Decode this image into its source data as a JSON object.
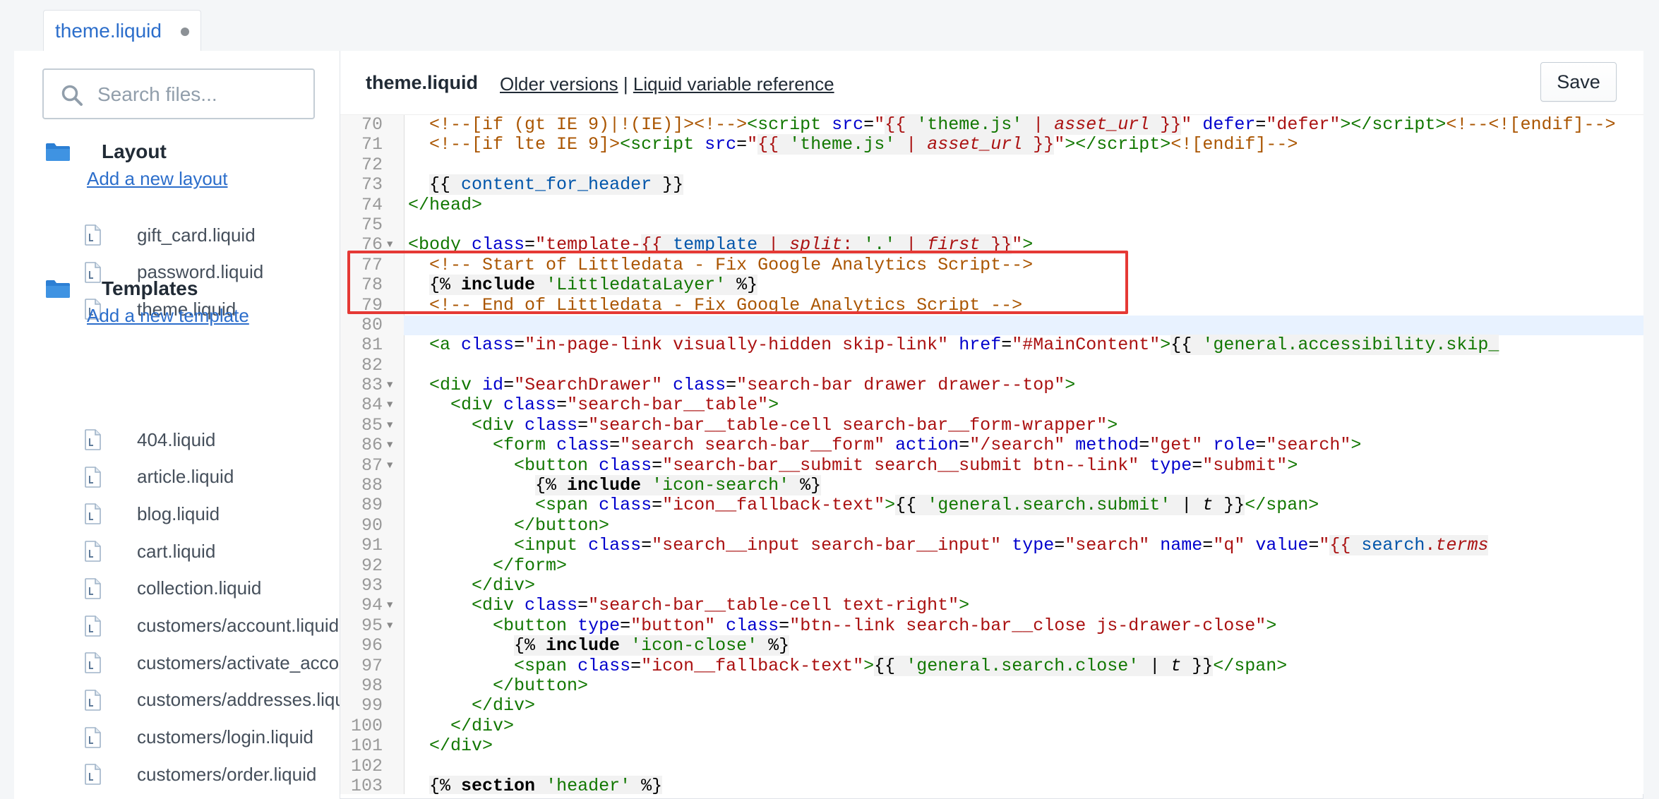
{
  "tab": {
    "label": "theme.liquid"
  },
  "sidebar": {
    "search_placeholder": "Search files...",
    "layout": {
      "title": "Layout",
      "add_link": "Add a new layout",
      "files": [
        "gift_card.liquid",
        "password.liquid",
        "theme.liquid"
      ]
    },
    "templates": {
      "title": "Templates",
      "add_link": "Add a new template",
      "files": [
        "404.liquid",
        "article.liquid",
        "blog.liquid",
        "cart.liquid",
        "collection.liquid",
        "customers/account.liquid",
        "customers/activate_account.liquid",
        "customers/addresses.liquid",
        "customers/login.liquid",
        "customers/order.liquid"
      ]
    }
  },
  "editor_header": {
    "title": "theme.liquid",
    "older_versions": "Older versions",
    "separator": "|",
    "liquid_reference": "Liquid variable reference",
    "save": "Save"
  },
  "code": {
    "active_line": 80,
    "highlighted_lines": [
      77,
      78,
      79
    ],
    "lines": [
      {
        "n": 70,
        "fold": false,
        "html": "  <span class=\"c-comment\">&lt;!--[if (gt IE 9)|!(IE)]&gt;&lt;!--&gt;</span><span class=\"c-tag\">&lt;script</span> <span class=\"c-attr\">src</span>=<span class=\"c-str\">\"<span class=\"liq-bg\">{{ <span class=\"c-lstr\">'theme.js'</span> | <span class=\"c-em\">asset_url</span> }}</span>\"</span> <span class=\"c-attr\">defer</span>=<span class=\"c-str\">\"defer\"</span><span class=\"c-tag\">&gt;&lt;/script&gt;</span><span class=\"c-comment\">&lt;!--&lt;![endif]--&gt;</span>"
      },
      {
        "n": 71,
        "fold": false,
        "html": "  <span class=\"c-comment\">&lt;!--[if lte IE 9]&gt;</span><span class=\"c-tag\">&lt;script</span> <span class=\"c-attr\">src</span>=<span class=\"c-str\">\"<span class=\"liq-bg\">{{ <span class=\"c-lstr\">'theme.js'</span> | <span class=\"c-em\">asset_url</span> }}</span>\"</span><span class=\"c-tag\">&gt;&lt;/script&gt;</span><span class=\"c-comment\">&lt;![endif]--&gt;</span>"
      },
      {
        "n": 72,
        "fold": false,
        "html": ""
      },
      {
        "n": 73,
        "fold": false,
        "html": "  <span class=\"liq-bg\">{{ <span class=\"c-var\">content_for_header</span> }}</span>"
      },
      {
        "n": 74,
        "fold": false,
        "html": "<span class=\"c-tag\">&lt;/head&gt;</span>"
      },
      {
        "n": 75,
        "fold": false,
        "html": ""
      },
      {
        "n": 76,
        "fold": true,
        "html": "<span class=\"c-tag\">&lt;body</span> <span class=\"c-attr\">class</span>=<span class=\"c-str\">\"template-<span class=\"liq-bg\">{{ <span class=\"c-var\">template</span> | <span class=\"c-em\">split</span>: <span class=\"c-lstr\">'.'</span> | <span class=\"c-em\">first</span> }}</span>\"</span><span class=\"c-tag\">&gt;</span>"
      },
      {
        "n": 77,
        "fold": false,
        "html": "  <span class=\"c-comment\">&lt;!-- Start of Littledata - Fix Google Analytics Script--&gt;</span>"
      },
      {
        "n": 78,
        "fold": false,
        "html": "  <span class=\"liq-bg\">{% <span class=\"c-kw\">include</span> <span class=\"c-lstr\">'LittledataLayer'</span> %}</span>"
      },
      {
        "n": 79,
        "fold": false,
        "html": "  <span class=\"c-comment\">&lt;!-- End of Littledata - Fix Google Analytics Script --&gt;</span>"
      },
      {
        "n": 80,
        "fold": false,
        "html": ""
      },
      {
        "n": 81,
        "fold": false,
        "html": "  <span class=\"c-tag\">&lt;a</span> <span class=\"c-attr\">class</span>=<span class=\"c-str\">\"in-page-link visually-hidden skip-link\"</span> <span class=\"c-attr\">href</span>=<span class=\"c-str\">\"#MainContent\"</span><span class=\"c-tag\">&gt;</span><span class=\"liq-bg\">{{ <span class=\"c-lstr\">'general.accessibility.skip_</span></span>"
      },
      {
        "n": 82,
        "fold": false,
        "html": ""
      },
      {
        "n": 83,
        "fold": true,
        "html": "  <span class=\"c-tag\">&lt;div</span> <span class=\"c-attr\">id</span>=<span class=\"c-str\">\"SearchDrawer\"</span> <span class=\"c-attr\">class</span>=<span class=\"c-str\">\"search-bar drawer drawer--top\"</span><span class=\"c-tag\">&gt;</span>"
      },
      {
        "n": 84,
        "fold": true,
        "html": "    <span class=\"c-tag\">&lt;div</span> <span class=\"c-attr\">class</span>=<span class=\"c-str\">\"search-bar__table\"</span><span class=\"c-tag\">&gt;</span>"
      },
      {
        "n": 85,
        "fold": true,
        "html": "      <span class=\"c-tag\">&lt;div</span> <span class=\"c-attr\">class</span>=<span class=\"c-str\">\"search-bar__table-cell search-bar__form-wrapper\"</span><span class=\"c-tag\">&gt;</span>"
      },
      {
        "n": 86,
        "fold": true,
        "html": "        <span class=\"c-tag\">&lt;form</span> <span class=\"c-attr\">class</span>=<span class=\"c-str\">\"search search-bar__form\"</span> <span class=\"c-attr\">action</span>=<span class=\"c-str\">\"/search\"</span> <span class=\"c-attr\">method</span>=<span class=\"c-str\">\"get\"</span> <span class=\"c-attr\">role</span>=<span class=\"c-str\">\"search\"</span><span class=\"c-tag\">&gt;</span>"
      },
      {
        "n": 87,
        "fold": true,
        "html": "          <span class=\"c-tag\">&lt;button</span> <span class=\"c-attr\">class</span>=<span class=\"c-str\">\"search-bar__submit search__submit btn--link\"</span> <span class=\"c-attr\">type</span>=<span class=\"c-str\">\"submit\"</span><span class=\"c-tag\">&gt;</span>"
      },
      {
        "n": 88,
        "fold": false,
        "html": "            <span class=\"liq-bg\">{% <span class=\"c-kw\">include</span> <span class=\"c-lstr\">'icon-search'</span> %}</span>"
      },
      {
        "n": 89,
        "fold": false,
        "html": "            <span class=\"c-tag\">&lt;span</span> <span class=\"c-attr\">class</span>=<span class=\"c-str\">\"icon__fallback-text\"</span><span class=\"c-tag\">&gt;</span><span class=\"liq-bg\">{{ <span class=\"c-lstr\">'general.search.submit'</span> | <span class=\"c-em\">t</span> }}</span><span class=\"c-tag\">&lt;/span&gt;</span>"
      },
      {
        "n": 90,
        "fold": false,
        "html": "          <span class=\"c-tag\">&lt;/button&gt;</span>"
      },
      {
        "n": 91,
        "fold": false,
        "html": "          <span class=\"c-tag\">&lt;input</span> <span class=\"c-attr\">class</span>=<span class=\"c-str\">\"search__input search-bar__input\"</span> <span class=\"c-attr\">type</span>=<span class=\"c-str\">\"search\"</span> <span class=\"c-attr\">name</span>=<span class=\"c-str\">\"q\"</span> <span class=\"c-attr\">value</span>=<span class=\"c-str\">\"<span class=\"liq-bg\">{{ <span class=\"c-var\">search</span>.<span class=\"c-em\">terms</span></span></span>"
      },
      {
        "n": 92,
        "fold": false,
        "html": "        <span class=\"c-tag\">&lt;/form&gt;</span>"
      },
      {
        "n": 93,
        "fold": false,
        "html": "      <span class=\"c-tag\">&lt;/div&gt;</span>"
      },
      {
        "n": 94,
        "fold": true,
        "html": "      <span class=\"c-tag\">&lt;div</span> <span class=\"c-attr\">class</span>=<span class=\"c-str\">\"search-bar__table-cell text-right\"</span><span class=\"c-tag\">&gt;</span>"
      },
      {
        "n": 95,
        "fold": true,
        "html": "        <span class=\"c-tag\">&lt;button</span> <span class=\"c-attr\">type</span>=<span class=\"c-str\">\"button\"</span> <span class=\"c-attr\">class</span>=<span class=\"c-str\">\"btn--link search-bar__close js-drawer-close\"</span><span class=\"c-tag\">&gt;</span>"
      },
      {
        "n": 96,
        "fold": false,
        "html": "          <span class=\"liq-bg\">{% <span class=\"c-kw\">include</span> <span class=\"c-lstr\">'icon-close'</span> %}</span>"
      },
      {
        "n": 97,
        "fold": false,
        "html": "          <span class=\"c-tag\">&lt;span</span> <span class=\"c-attr\">class</span>=<span class=\"c-str\">\"icon__fallback-text\"</span><span class=\"c-tag\">&gt;</span><span class=\"liq-bg\">{{ <span class=\"c-lstr\">'general.search.close'</span> | <span class=\"c-em\">t</span> }}</span><span class=\"c-tag\">&lt;/span&gt;</span>"
      },
      {
        "n": 98,
        "fold": false,
        "html": "        <span class=\"c-tag\">&lt;/button&gt;</span>"
      },
      {
        "n": 99,
        "fold": false,
        "html": "      <span class=\"c-tag\">&lt;/div&gt;</span>"
      },
      {
        "n": 100,
        "fold": false,
        "html": "    <span class=\"c-tag\">&lt;/div&gt;</span>"
      },
      {
        "n": 101,
        "fold": false,
        "html": "  <span class=\"c-tag\">&lt;/div&gt;</span>"
      },
      {
        "n": 102,
        "fold": false,
        "html": ""
      },
      {
        "n": 103,
        "fold": false,
        "html": "  <span class=\"liq-bg\">{% <span class=\"c-kw\">section</span> <span class=\"c-lstr\">'header'</span> %}</span>"
      }
    ]
  }
}
